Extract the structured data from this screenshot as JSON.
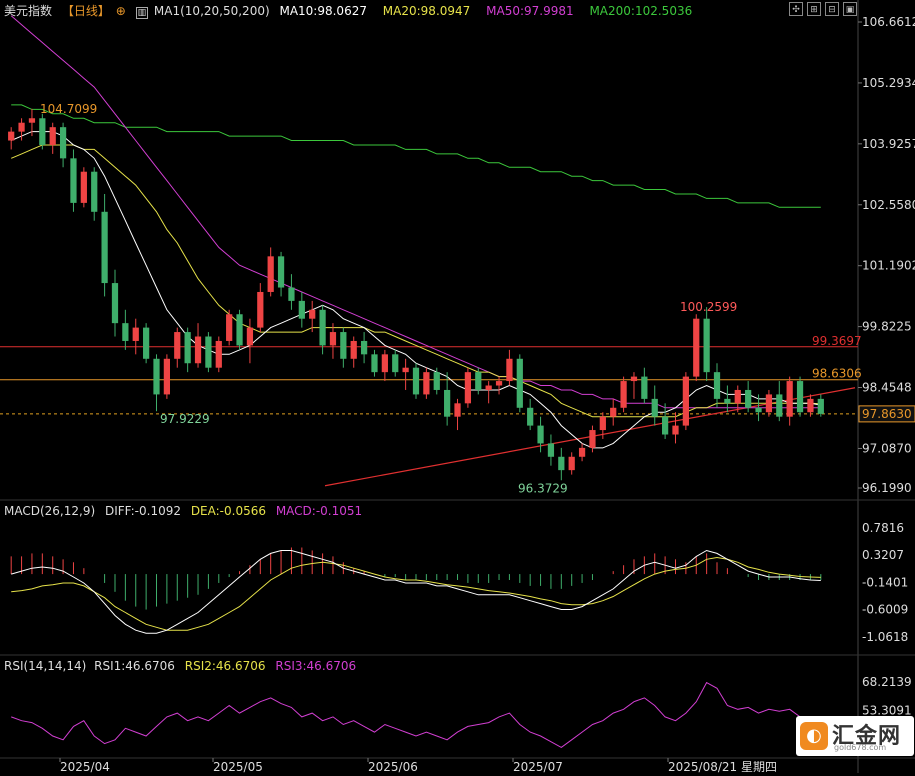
{
  "header": {
    "title": "美元指数",
    "period": "【日线】",
    "ma_label": "MA1(10,20,50,200)",
    "ma10": "MA10:98.0627",
    "ma20": "MA20:98.0947",
    "ma50": "MA50:97.9981",
    "ma200": "MA200:102.5036",
    "macd_label": "MACD(26,12,9)",
    "diff": "DIFF:-0.1092",
    "dea": "DEA:-0.0566",
    "macd": "MACD:-0.1051",
    "rsi_label": "RSI(14,14,14)",
    "rsi1": "RSI1:46.6706",
    "rsi2": "RSI2:46.6706",
    "rsi3": "RSI3:46.6706"
  },
  "logo": {
    "name": "汇金网",
    "url": "gold678.com"
  },
  "colors": {
    "up": "#ee4444",
    "down": "#3fae6b",
    "ma10": "#ffffff",
    "ma20": "#e6e24a",
    "ma50": "#d23fd2",
    "ma200": "#3cc83c",
    "hline_red": "#e03030",
    "hline_orange": "#e8972a",
    "trend": "#e03030",
    "dashed": "#e0a020"
  },
  "chart_data": [
    {
      "type": "candlestick",
      "ylim": [
        96.199,
        106.6612
      ],
      "y_ticks": [
        "106.6612",
        "105.2934",
        "103.9257",
        "102.5580",
        "101.1902",
        "99.8225",
        "98.4548",
        "97.0870",
        "96.1990"
      ],
      "x_ticks": [
        "2025/04",
        "2025/05",
        "2025/06",
        "2025/07",
        "2025/08/21 星期四"
      ],
      "annotations": [
        {
          "text": "104.7099",
          "value": 104.7099
        },
        {
          "text": "97.9229",
          "value": 97.9229
        },
        {
          "text": "96.3729",
          "value": 96.3729
        },
        {
          "text": "100.2599",
          "value": 100.2599
        },
        {
          "text": "99.3697",
          "value": 99.3697
        },
        {
          "text": "98.6306",
          "value": 98.6306
        },
        {
          "text": "97.8630",
          "value": 97.863
        }
      ],
      "ohlc": [
        [
          104.0,
          104.3,
          103.8,
          104.2
        ],
        [
          104.2,
          104.5,
          104.0,
          104.4
        ],
        [
          104.4,
          104.7099,
          104.1,
          104.5
        ],
        [
          104.5,
          104.6,
          103.8,
          103.9
        ],
        [
          103.9,
          104.4,
          103.7,
          104.3
        ],
        [
          104.3,
          104.4,
          103.4,
          103.6
        ],
        [
          103.6,
          103.8,
          102.4,
          102.6
        ],
        [
          102.6,
          103.4,
          102.5,
          103.3
        ],
        [
          103.3,
          103.4,
          102.2,
          102.4
        ],
        [
          102.4,
          102.8,
          100.5,
          100.8
        ],
        [
          100.8,
          101.1,
          99.6,
          99.9
        ],
        [
          99.9,
          100.2,
          99.3,
          99.5
        ],
        [
          99.5,
          100.0,
          99.2,
          99.8
        ],
        [
          99.8,
          99.9,
          99.0,
          99.1
        ],
        [
          99.1,
          99.2,
          97.9229,
          98.3
        ],
        [
          98.3,
          99.2,
          98.2,
          99.1
        ],
        [
          99.1,
          99.8,
          98.9,
          99.7
        ],
        [
          99.7,
          99.8,
          98.8,
          99.0
        ],
        [
          99.0,
          99.9,
          98.9,
          99.6
        ],
        [
          99.6,
          99.7,
          98.8,
          98.9
        ],
        [
          98.9,
          99.6,
          98.8,
          99.5
        ],
        [
          99.5,
          100.2,
          99.4,
          100.1
        ],
        [
          100.1,
          100.2,
          99.3,
          99.4
        ],
        [
          99.4,
          100.0,
          99.0,
          99.8
        ],
        [
          99.8,
          100.8,
          99.7,
          100.6
        ],
        [
          100.6,
          101.6,
          100.5,
          101.4
        ],
        [
          101.4,
          101.5,
          100.5,
          100.7
        ],
        [
          100.7,
          101.0,
          100.2,
          100.4
        ],
        [
          100.4,
          100.6,
          99.8,
          100.0
        ],
        [
          100.0,
          100.4,
          99.7,
          100.2
        ],
        [
          100.2,
          100.3,
          99.2,
          99.4
        ],
        [
          99.4,
          99.9,
          99.1,
          99.7
        ],
        [
          99.7,
          99.8,
          98.9,
          99.1
        ],
        [
          99.1,
          99.6,
          98.9,
          99.5
        ],
        [
          99.5,
          99.7,
          99.0,
          99.2
        ],
        [
          99.2,
          99.3,
          98.7,
          98.8
        ],
        [
          98.8,
          99.3,
          98.6,
          99.2
        ],
        [
          99.2,
          99.3,
          98.7,
          98.8
        ],
        [
          98.8,
          99.1,
          98.4,
          98.9
        ],
        [
          98.9,
          99.0,
          98.2,
          98.3
        ],
        [
          98.3,
          98.9,
          98.2,
          98.8
        ],
        [
          98.8,
          98.9,
          98.3,
          98.4
        ],
        [
          98.4,
          98.8,
          97.6,
          97.8
        ],
        [
          97.8,
          98.2,
          97.5,
          98.1
        ],
        [
          98.1,
          98.9,
          98.0,
          98.8
        ],
        [
          98.8,
          98.9,
          98.3,
          98.4
        ],
        [
          98.4,
          98.6,
          98.1,
          98.5
        ],
        [
          98.5,
          98.7,
          98.3,
          98.6
        ],
        [
          98.6,
          99.3,
          98.5,
          99.1
        ],
        [
          99.1,
          99.2,
          97.9,
          98.0
        ],
        [
          98.0,
          98.2,
          97.5,
          97.6
        ],
        [
          97.6,
          97.8,
          97.0,
          97.2
        ],
        [
          97.2,
          97.4,
          96.7,
          96.9
        ],
        [
          96.9,
          97.1,
          96.3729,
          96.6
        ],
        [
          96.6,
          97.0,
          96.5,
          96.9
        ],
        [
          96.9,
          97.2,
          96.8,
          97.1
        ],
        [
          97.1,
          97.6,
          97.0,
          97.5
        ],
        [
          97.5,
          97.9,
          97.3,
          97.8
        ],
        [
          97.8,
          98.2,
          97.6,
          98.0
        ],
        [
          98.0,
          98.7,
          97.9,
          98.6
        ],
        [
          98.6,
          98.8,
          98.2,
          98.7
        ],
        [
          98.7,
          98.9,
          98.1,
          98.2
        ],
        [
          98.2,
          98.5,
          97.6,
          97.8
        ],
        [
          97.8,
          98.1,
          97.3,
          97.4
        ],
        [
          97.4,
          97.9,
          97.2,
          97.6
        ],
        [
          97.6,
          98.8,
          97.5,
          98.7
        ],
        [
          98.7,
          100.1,
          98.6,
          100.0
        ],
        [
          100.0,
          100.2599,
          98.6,
          98.8
        ],
        [
          98.8,
          99.0,
          98.0,
          98.2
        ],
        [
          98.2,
          98.5,
          97.9,
          98.1
        ],
        [
          98.1,
          98.5,
          97.9,
          98.4
        ],
        [
          98.4,
          98.6,
          97.9,
          98.0
        ],
        [
          98.0,
          98.3,
          97.7,
          97.9
        ],
        [
          97.9,
          98.4,
          97.8,
          98.3
        ],
        [
          98.3,
          98.6,
          97.7,
          97.8
        ],
        [
          97.8,
          98.7,
          97.6,
          98.6
        ],
        [
          98.6,
          98.7,
          97.8,
          97.9
        ],
        [
          97.9,
          98.3,
          97.8,
          98.2
        ],
        [
          98.2,
          98.3,
          97.8,
          97.863
        ]
      ],
      "ma10": [
        104.0,
        104.1,
        104.2,
        104.2,
        104.2,
        104.1,
        103.9,
        103.8,
        103.6,
        103.2,
        102.7,
        102.2,
        101.7,
        101.2,
        100.7,
        100.2,
        99.9,
        99.6,
        99.4,
        99.3,
        99.2,
        99.2,
        99.3,
        99.4,
        99.6,
        99.8,
        99.9,
        100.0,
        100.1,
        100.2,
        100.3,
        100.2,
        100.0,
        99.9,
        99.8,
        99.6,
        99.4,
        99.3,
        99.2,
        99.0,
        98.9,
        98.8,
        98.7,
        98.5,
        98.4,
        98.4,
        98.4,
        98.4,
        98.5,
        98.4,
        98.3,
        98.1,
        97.9,
        97.6,
        97.4,
        97.2,
        97.1,
        97.1,
        97.2,
        97.4,
        97.6,
        97.8,
        97.9,
        97.9,
        98.0,
        98.2,
        98.4,
        98.5,
        98.4,
        98.3,
        98.3,
        98.3,
        98.2,
        98.2,
        98.2,
        98.1,
        98.1,
        98.1,
        98.06
      ],
      "ma20": [
        103.6,
        103.7,
        103.8,
        103.9,
        103.9,
        103.9,
        103.9,
        103.8,
        103.8,
        103.6,
        103.4,
        103.2,
        103.0,
        102.7,
        102.4,
        102.0,
        101.7,
        101.3,
        100.9,
        100.6,
        100.3,
        100.1,
        99.9,
        99.8,
        99.7,
        99.7,
        99.7,
        99.7,
        99.7,
        99.8,
        99.8,
        99.8,
        99.8,
        99.8,
        99.8,
        99.7,
        99.7,
        99.6,
        99.5,
        99.4,
        99.3,
        99.2,
        99.1,
        99.0,
        98.9,
        98.8,
        98.8,
        98.7,
        98.7,
        98.6,
        98.5,
        98.4,
        98.3,
        98.1,
        98.0,
        97.9,
        97.8,
        97.8,
        97.8,
        97.8,
        97.8,
        97.8,
        97.8,
        97.8,
        97.8,
        97.9,
        98.0,
        98.0,
        98.1,
        98.1,
        98.1,
        98.1,
        98.1,
        98.1,
        98.1,
        98.1,
        98.1,
        98.1,
        98.09
      ],
      "ma50": [
        106.8,
        106.6,
        106.4,
        106.2,
        106.0,
        105.8,
        105.6,
        105.4,
        105.2,
        104.9,
        104.6,
        104.3,
        104.0,
        103.7,
        103.4,
        103.1,
        102.8,
        102.5,
        102.2,
        101.9,
        101.6,
        101.4,
        101.2,
        101.1,
        101.0,
        100.9,
        100.8,
        100.7,
        100.6,
        100.5,
        100.4,
        100.3,
        100.2,
        100.1,
        100.0,
        99.9,
        99.8,
        99.7,
        99.6,
        99.5,
        99.4,
        99.3,
        99.2,
        99.1,
        99.0,
        98.9,
        98.8,
        98.7,
        98.7,
        98.6,
        98.6,
        98.5,
        98.5,
        98.4,
        98.4,
        98.3,
        98.3,
        98.2,
        98.2,
        98.1,
        98.1,
        98.1,
        98.1,
        98.0,
        98.0,
        98.0,
        98.0,
        98.0,
        98.0,
        98.0,
        98.0,
        98.0,
        98.0,
        98.0,
        98.0,
        98.0,
        98.0,
        98.0,
        98.0
      ],
      "ma200": [
        104.8,
        104.8,
        104.7,
        104.7,
        104.6,
        104.6,
        104.5,
        104.5,
        104.4,
        104.4,
        104.4,
        104.3,
        104.3,
        104.3,
        104.3,
        104.2,
        104.2,
        104.2,
        104.2,
        104.2,
        104.2,
        104.1,
        104.1,
        104.1,
        104.1,
        104.1,
        104.1,
        104.0,
        104.0,
        104.0,
        104.0,
        104.0,
        104.0,
        103.9,
        103.9,
        103.9,
        103.9,
        103.9,
        103.8,
        103.8,
        103.8,
        103.7,
        103.7,
        103.7,
        103.6,
        103.6,
        103.5,
        103.5,
        103.4,
        103.4,
        103.4,
        103.3,
        103.3,
        103.3,
        103.2,
        103.2,
        103.1,
        103.1,
        103.0,
        103.0,
        103.0,
        102.9,
        102.9,
        102.9,
        102.8,
        102.8,
        102.8,
        102.7,
        102.7,
        102.7,
        102.6,
        102.6,
        102.6,
        102.6,
        102.5,
        102.5,
        102.5,
        102.5,
        102.5
      ]
    },
    {
      "type": "bar",
      "ylim": [
        -1.2,
        1.0
      ],
      "y_ticks": [
        "0.7816",
        "0.3207",
        "-0.1401",
        "-0.6009",
        "-1.0618"
      ],
      "macd": [
        0.3,
        0.3,
        0.35,
        0.35,
        0.3,
        0.25,
        0.2,
        0.1,
        0.0,
        -0.15,
        -0.3,
        -0.45,
        -0.55,
        -0.6,
        -0.55,
        -0.5,
        -0.45,
        -0.4,
        -0.35,
        -0.25,
        -0.15,
        -0.05,
        0.05,
        0.15,
        0.25,
        0.35,
        0.4,
        0.45,
        0.45,
        0.4,
        0.35,
        0.3,
        0.2,
        0.1,
        0.05,
        0.0,
        -0.05,
        -0.05,
        -0.1,
        -0.1,
        -0.1,
        -0.1,
        -0.1,
        -0.1,
        -0.15,
        -0.15,
        -0.15,
        -0.1,
        -0.1,
        -0.15,
        -0.2,
        -0.2,
        -0.25,
        -0.25,
        -0.2,
        -0.15,
        -0.1,
        0.0,
        0.05,
        0.15,
        0.25,
        0.3,
        0.35,
        0.3,
        0.25,
        0.2,
        0.3,
        0.35,
        0.2,
        0.1,
        0.0,
        -0.05,
        -0.1,
        -0.1,
        -0.1,
        -0.1,
        -0.1,
        -0.1,
        -0.1
      ],
      "diff": [
        0.0,
        0.05,
        0.1,
        0.12,
        0.1,
        0.05,
        -0.05,
        -0.15,
        -0.3,
        -0.5,
        -0.7,
        -0.85,
        -0.95,
        -1.0,
        -1.0,
        -0.95,
        -0.85,
        -0.75,
        -0.65,
        -0.5,
        -0.35,
        -0.2,
        -0.05,
        0.1,
        0.25,
        0.35,
        0.4,
        0.4,
        0.35,
        0.3,
        0.25,
        0.2,
        0.1,
        0.05,
        0.0,
        -0.05,
        -0.1,
        -0.1,
        -0.15,
        -0.15,
        -0.15,
        -0.2,
        -0.2,
        -0.25,
        -0.3,
        -0.35,
        -0.35,
        -0.35,
        -0.35,
        -0.4,
        -0.45,
        -0.5,
        -0.55,
        -0.6,
        -0.6,
        -0.55,
        -0.45,
        -0.35,
        -0.25,
        -0.1,
        0.05,
        0.15,
        0.2,
        0.15,
        0.1,
        0.15,
        0.3,
        0.4,
        0.35,
        0.25,
        0.15,
        0.05,
        0.0,
        -0.05,
        -0.05,
        -0.05,
        -0.08,
        -0.1,
        -0.1092
      ],
      "dea": [
        -0.3,
        -0.28,
        -0.25,
        -0.2,
        -0.18,
        -0.15,
        -0.15,
        -0.2,
        -0.3,
        -0.4,
        -0.55,
        -0.65,
        -0.75,
        -0.85,
        -0.9,
        -0.95,
        -0.95,
        -0.95,
        -0.9,
        -0.85,
        -0.75,
        -0.65,
        -0.55,
        -0.4,
        -0.25,
        -0.1,
        0.0,
        0.1,
        0.15,
        0.18,
        0.2,
        0.18,
        0.15,
        0.1,
        0.05,
        0.0,
        -0.05,
        -0.08,
        -0.1,
        -0.1,
        -0.12,
        -0.15,
        -0.18,
        -0.2,
        -0.22,
        -0.25,
        -0.28,
        -0.3,
        -0.32,
        -0.35,
        -0.38,
        -0.42,
        -0.45,
        -0.5,
        -0.52,
        -0.52,
        -0.5,
        -0.45,
        -0.38,
        -0.28,
        -0.18,
        -0.08,
        0.0,
        0.05,
        0.08,
        0.1,
        0.15,
        0.25,
        0.28,
        0.25,
        0.2,
        0.12,
        0.08,
        0.03,
        0.0,
        -0.02,
        -0.04,
        -0.05,
        -0.0566
      ]
    },
    {
      "type": "line",
      "ylim": [
        30,
        72
      ],
      "y_ticks": [
        "68.2139",
        "53.3091"
      ],
      "rsi": [
        50,
        48,
        47,
        44,
        40,
        38,
        45,
        48,
        40,
        36,
        38,
        44,
        42,
        40,
        45,
        50,
        52,
        48,
        50,
        48,
        52,
        56,
        52,
        55,
        58,
        60,
        57,
        55,
        50,
        52,
        48,
        50,
        46,
        48,
        45,
        42,
        46,
        44,
        42,
        40,
        42,
        40,
        38,
        42,
        45,
        46,
        47,
        50,
        52,
        46,
        42,
        40,
        37,
        34,
        38,
        42,
        46,
        48,
        52,
        54,
        58,
        60,
        56,
        50,
        48,
        52,
        58,
        68,
        65,
        56,
        54,
        55,
        52,
        54,
        53,
        54,
        50,
        50,
        46.67
      ]
    }
  ]
}
